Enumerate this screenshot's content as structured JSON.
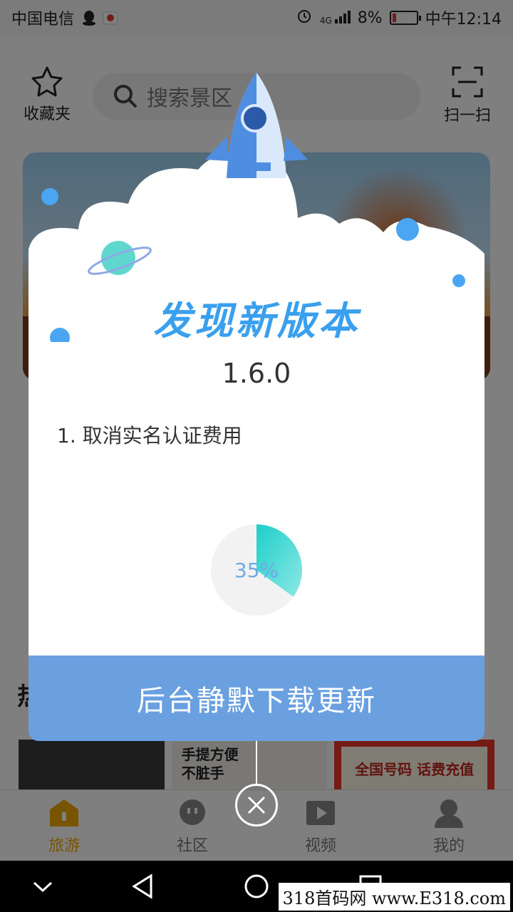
{
  "status_bar": {
    "carrier": "中国电信",
    "battery": "8%",
    "time": "中午12:14",
    "network": "4G"
  },
  "header": {
    "favorites_label": "收藏夹",
    "search_placeholder": "搜索景区",
    "scan_label": "扫一扫"
  },
  "section": {
    "title": "热"
  },
  "thumbs": {
    "item2_line1": "手提方便",
    "item2_line2": "不脏手",
    "item3_text": "全国号码 话费充值"
  },
  "tabs": [
    {
      "label": "旅游",
      "icon": "home-icon",
      "active": true
    },
    {
      "label": "社区",
      "icon": "chat-icon",
      "active": false
    },
    {
      "label": "视频",
      "icon": "video-icon",
      "active": false
    },
    {
      "label": "我的",
      "icon": "profile-icon",
      "active": false
    }
  ],
  "dialog": {
    "title": "发现新版本",
    "version": "1.6.0",
    "notes": "1. 取消实名认证费用",
    "progress": 35,
    "progress_label": "35%",
    "button": "后台静默下载更新"
  },
  "watermark": "318首码网 www.E318.com",
  "colors": {
    "accent_blue": "#6aa0e0",
    "title_blue": "#3aa0ee",
    "progress_teal": "#1ccfc9",
    "tab_active": "#f2a800"
  }
}
